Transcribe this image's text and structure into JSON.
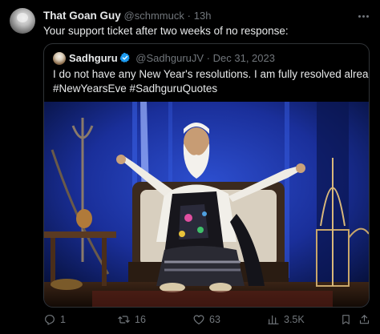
{
  "tweet": {
    "author_name": "That Goan Guy",
    "handle": "@schmmuck",
    "separator": "·",
    "time": "13h",
    "text": "Your support ticket after two weeks of no response:"
  },
  "quote": {
    "author_name": "Sadhguru",
    "handle": "@SadhguruJV",
    "separator": "·",
    "date": "Dec 31, 2023",
    "text_line1": "I do not have any New Year's resolutions. I am fully resolved already.",
    "text_line2": "#NewYearsEve #SadhguruQuotes",
    "verified_color": "#1d9bf0"
  },
  "actions": {
    "reply_count": "1",
    "repost_count": "16",
    "like_count": "63",
    "views_count": "3.5K"
  },
  "icons": {
    "more": "more-dots-icon",
    "verified": "verified-badge-icon",
    "reply": "reply-icon",
    "repost": "repost-icon",
    "like": "heart-icon",
    "views": "views-chart-icon",
    "bookmark": "bookmark-icon",
    "share": "share-icon"
  }
}
